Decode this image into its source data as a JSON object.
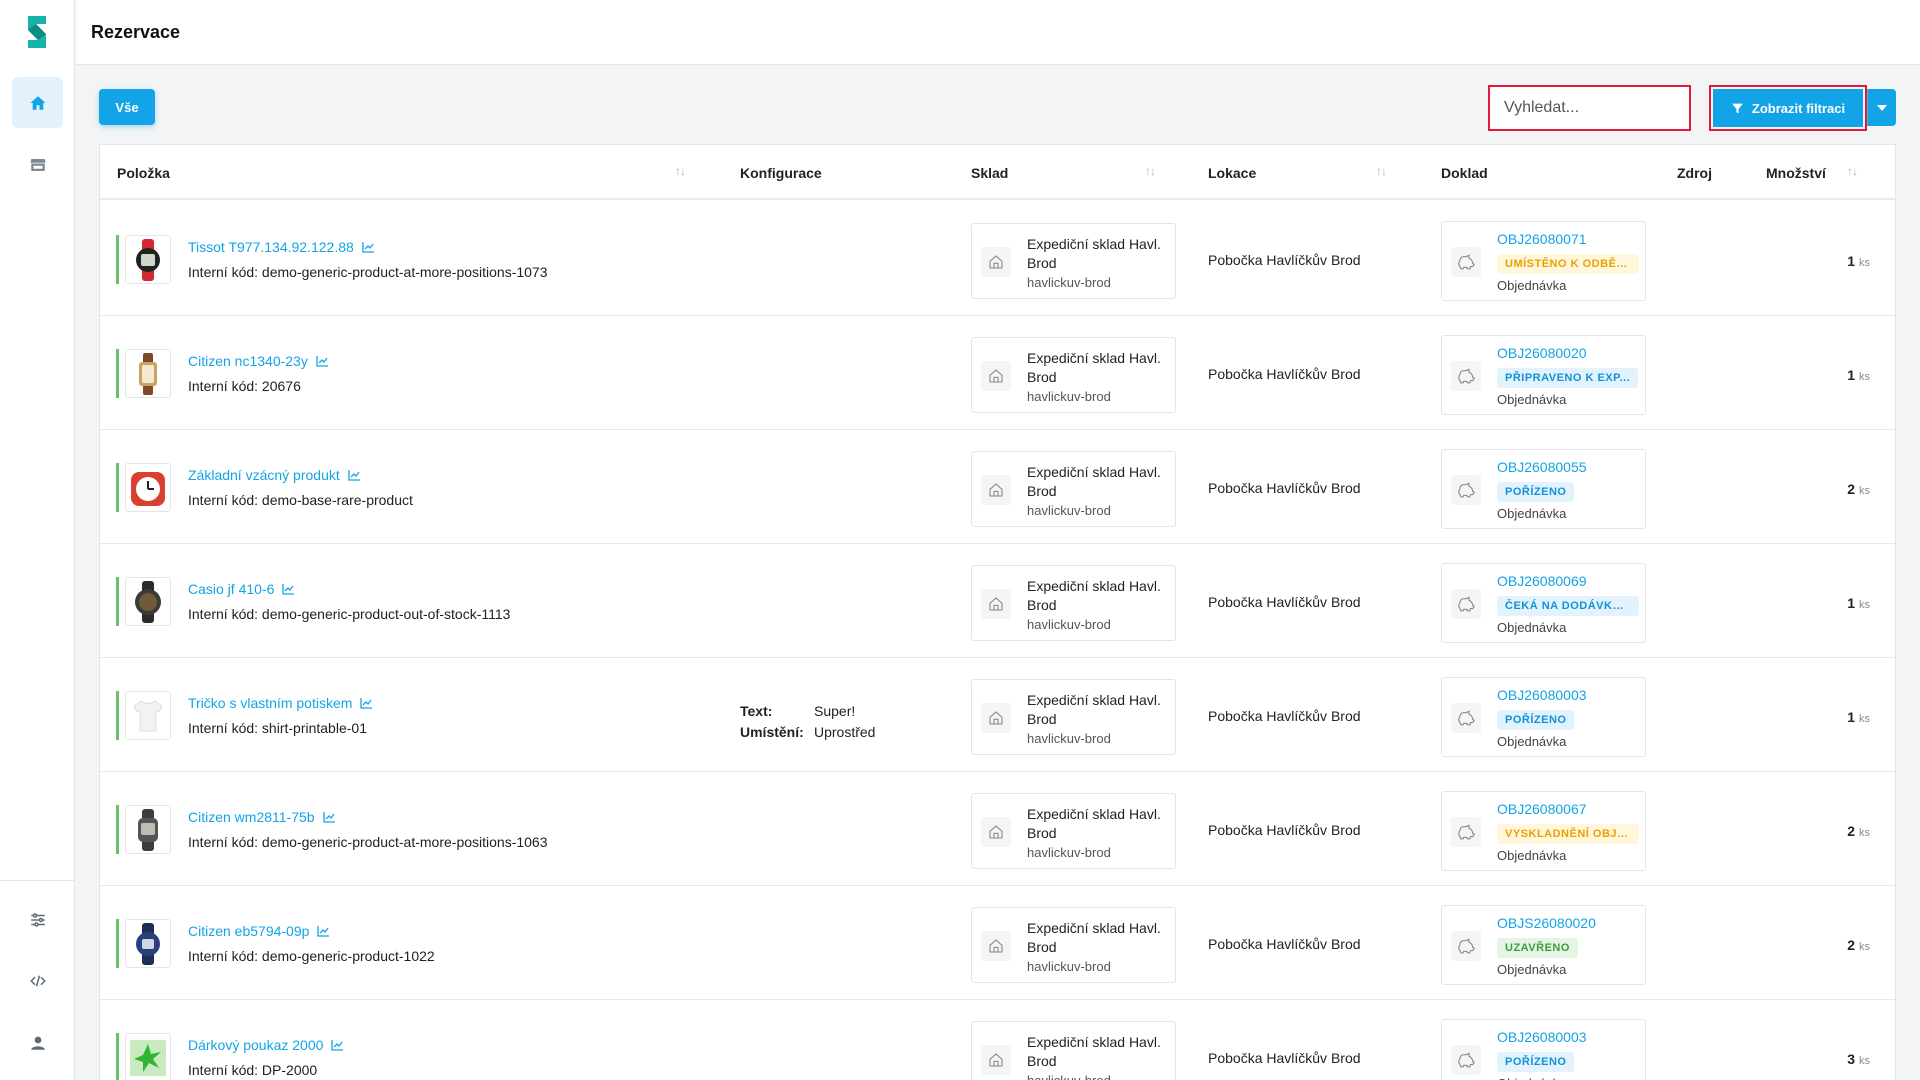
{
  "header": {
    "title": "Rezervace"
  },
  "toolbar": {
    "all_label": "Vše",
    "search_placeholder": "Vyhledat...",
    "filter_label": "Zobrazit filtraci"
  },
  "columns": {
    "item": "Položka",
    "config": "Konfigurace",
    "warehouse": "Sklad",
    "location": "Lokace",
    "document": "Doklad",
    "source": "Zdroj",
    "quantity": "Množství"
  },
  "colors": {
    "accent": "#12a4e7",
    "highlight": "#e3193b",
    "stock": "#6cc26b"
  },
  "rows": [
    {
      "name": "Tissot T977.134.92.122.88",
      "code": "Interní kód: demo-generic-product-at-more-positions-1073",
      "thumb": "red-watch",
      "config": [],
      "warehouse": "Expediční sklad Havl. Brod",
      "wh_code": "havlickuv-brod",
      "location": "Pobočka Havlíčkův Brod",
      "doc": "OBJ26080071",
      "status": "UMÍSTĚNO K ODBĚR...",
      "status_type": "warn",
      "doc_type": "Objednávka",
      "qty": "1",
      "unit": "ks"
    },
    {
      "name": "Citizen nc1340-23y",
      "code": "Interní kód: 20676",
      "thumb": "brown-watch",
      "config": [],
      "warehouse": "Expediční sklad Havl. Brod",
      "wh_code": "havlickuv-brod",
      "location": "Pobočka Havlíčkův Brod",
      "doc": "OBJ26080020",
      "status": "PŘIPRAVENO K EXP...",
      "status_type": "info",
      "doc_type": "Objednávka",
      "qty": "1",
      "unit": "ks"
    },
    {
      "name": "Základní vzácný produkt",
      "code": "Interní kód: demo-base-rare-product",
      "thumb": "alarm-clock",
      "config": [],
      "warehouse": "Expediční sklad Havl. Brod",
      "wh_code": "havlickuv-brod",
      "location": "Pobočka Havlíčkův Brod",
      "doc": "OBJ26080055",
      "status": "POŘÍZENO",
      "status_type": "info",
      "doc_type": "Objednávka",
      "qty": "2",
      "unit": "ks"
    },
    {
      "name": "Casio jf 410-6",
      "code": "Interní kód: demo-generic-product-out-of-stock-1113",
      "thumb": "black-watch",
      "config": [],
      "warehouse": "Expediční sklad Havl. Brod",
      "wh_code": "havlickuv-brod",
      "location": "Pobočka Havlíčkův Brod",
      "doc": "OBJ26080069",
      "status": "ČEKÁ NA DODÁVKU ...",
      "status_type": "info",
      "doc_type": "Objednávka",
      "qty": "1",
      "unit": "ks"
    },
    {
      "name": "Tričko s vlastním potiskem",
      "code": "Interní kód: shirt-printable-01",
      "thumb": "tshirt",
      "config": [
        {
          "label": "Text:",
          "value": "Super!"
        },
        {
          "label": "Umístění:",
          "value": "Uprostřed"
        }
      ],
      "warehouse": "Expediční sklad Havl. Brod",
      "wh_code": "havlickuv-brod",
      "location": "Pobočka Havlíčkův Brod",
      "doc": "OBJ26080003",
      "status": "POŘÍZENO",
      "status_type": "info",
      "doc_type": "Objednávka",
      "qty": "1",
      "unit": "ks"
    },
    {
      "name": "Citizen wm2811-75b",
      "code": "Interní kód: demo-generic-product-at-more-positions-1063",
      "thumb": "gray-watch",
      "config": [],
      "warehouse": "Expediční sklad Havl. Brod",
      "wh_code": "havlickuv-brod",
      "location": "Pobočka Havlíčkův Brod",
      "doc": "OBJ26080067",
      "status": "VYSKLADNĚNÍ OBJE...",
      "status_type": "warn",
      "doc_type": "Objednávka",
      "qty": "2",
      "unit": "ks"
    },
    {
      "name": "Citizen eb5794-09p",
      "code": "Interní kód: demo-generic-product-1022",
      "thumb": "blue-watch",
      "config": [],
      "warehouse": "Expediční sklad Havl. Brod",
      "wh_code": "havlickuv-brod",
      "location": "Pobočka Havlíčkův Brod",
      "doc": "OBJS26080020",
      "status": "UZAVŘENO",
      "status_type": "ok",
      "doc_type": "Objednávka",
      "qty": "2",
      "unit": "ks"
    },
    {
      "name": "Dárkový poukaz 2000",
      "code": "Interní kód: DP-2000",
      "thumb": "gift-voucher",
      "config": [],
      "warehouse": "Expediční sklad Havl. Brod",
      "wh_code": "havlickuv-brod",
      "location": "Pobočka Havlíčkův Brod",
      "doc": "OBJ26080003",
      "status": "POŘÍZENO",
      "status_type": "info",
      "doc_type": "Objednávka",
      "qty": "3",
      "unit": "ks"
    }
  ]
}
